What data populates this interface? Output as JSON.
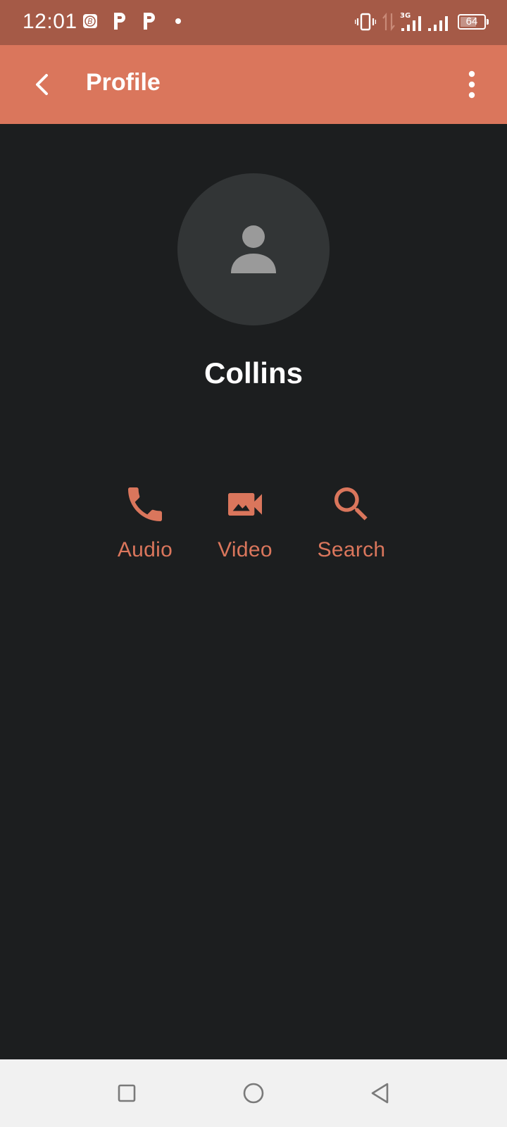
{
  "status_bar": {
    "time": "12:01",
    "battery_level": "64",
    "network": "3G",
    "left_icons": [
      "notification-b-icon",
      "parking-p-icon",
      "parking-p-icon",
      "dot-icon"
    ],
    "right_icons": [
      "vibrate-icon",
      "data-transfer-icon",
      "signal-icon",
      "signal-icon",
      "battery-icon"
    ]
  },
  "app_bar": {
    "title": "Profile",
    "back_icon": "chevron-left-icon",
    "menu_icon": "more-vert-icon"
  },
  "profile": {
    "name": "Collins",
    "avatar_icon": "person-icon"
  },
  "actions": [
    {
      "label": "Audio",
      "icon": "phone-icon"
    },
    {
      "label": "Video",
      "icon": "videocam-icon"
    },
    {
      "label": "Search",
      "icon": "search-icon"
    }
  ],
  "nav_bar": {
    "buttons": [
      "recents-square-icon",
      "home-circle-icon",
      "back-triangle-icon"
    ]
  },
  "colors": {
    "status_bar": "#a55a47",
    "app_bar": "#da765c",
    "accent": "#da765c",
    "background": "#1c1e1f",
    "avatar_bg": "#323536",
    "avatar_icon": "#9a9a9a",
    "nav_bar": "#f1f1f1"
  }
}
